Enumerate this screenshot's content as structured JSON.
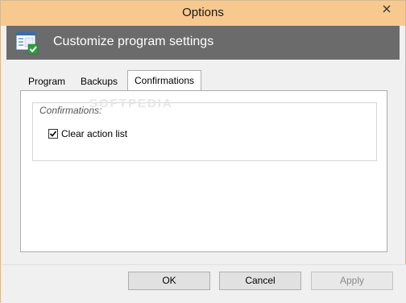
{
  "window": {
    "title": "Options"
  },
  "header": {
    "text": "Customize program settings",
    "icon": "settings-window-check-icon"
  },
  "tabs": [
    {
      "label": "Program",
      "active": false
    },
    {
      "label": "Backups",
      "active": false
    },
    {
      "label": "Confirmations",
      "active": true
    }
  ],
  "confirmations": {
    "group_label": "Confirmations:",
    "clear_action_list": {
      "label": "Clear action list",
      "checked": true
    }
  },
  "watermark": "SOFTPEDIA",
  "buttons": {
    "ok": "OK",
    "cancel": "Cancel",
    "apply": "Apply"
  },
  "colors": {
    "titlebar": "#f7c98f",
    "header_band": "#6b6b6b"
  }
}
